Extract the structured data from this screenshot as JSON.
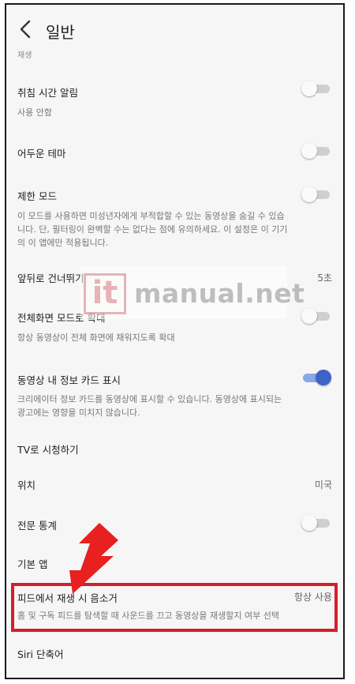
{
  "header": {
    "title": "일반"
  },
  "clipped_text": "재생",
  "rows": [
    {
      "title": "취침 시간 알림",
      "sub": "사용 안함",
      "toggle": "off"
    },
    {
      "title": "어두운 테마",
      "toggle": "off"
    },
    {
      "title": "제한 모드",
      "sub": "이 모드를 사용하면 미성년자에게 부적합할 수 있는 동영상을 숨길 수 있습니다. 단, 필터링이 완벽할 수는 없다는 점에 유의하세요. 이 설정은 이 기기의 이 앱에만 적용됩니다.",
      "toggle": "off"
    },
    {
      "title": "앞뒤로 건너뛰기",
      "value": "5초"
    },
    {
      "title": "전체화면 모드로 확대",
      "sub": "항상 동영상이 전체 화면에 채워지도록 확대",
      "toggle": "off"
    },
    {
      "title": "동영상 내 정보 카드 표시",
      "sub": "크리에이터 정보 카드를 동영상에 표시할 수 있습니다. 동영상에 표시되는 광고에는 영향을 미치지 않습니다.",
      "toggle": "on"
    },
    {
      "title": "TV로 시청하기"
    },
    {
      "title": "위치",
      "value": "미국"
    },
    {
      "title": "전문 통계",
      "toggle": "off"
    },
    {
      "title": "기본 앱"
    },
    {
      "title": "피드에서 재생 시 음소거",
      "sub": "홈 및 구독 피드를 탐색할 때 사운드를 끄고 동영상을 재생할지 여부 선택",
      "value": "항상 사용"
    },
    {
      "title": "Siri 단축어"
    }
  ],
  "watermark": {
    "logo": "it",
    "text": "manual.net"
  },
  "colors": {
    "highlight": "#d51f2b",
    "toggle_on": "#3d63c6",
    "arrow": "#e8201f"
  }
}
